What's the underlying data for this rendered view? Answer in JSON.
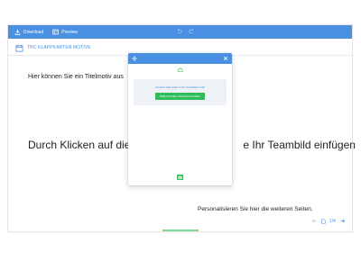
{
  "toolbar": {
    "download_label": "Download",
    "preview_label": "Preview",
    "undo_icon": "undo-icon",
    "redo_icon": "redo-icon"
  },
  "document": {
    "title": "TRC KLAPPKARTEN MOTIVE"
  },
  "canvas": {
    "title_motif_text": "Hier können Sie ein Titelmotiv aus",
    "team_photo_text_left": "Durch Klicken auf die w",
    "team_photo_text_right": "e Ihr Teambild einfügen",
    "personalize_text": "Personalisieren Sie hier die weiteren Seiten."
  },
  "pager": {
    "page_indicator": "1/4"
  },
  "modal": {
    "panel_text": "FÜGEN SIE HIER IHR TEAMBILD EIN",
    "search_button_label": "BIBLIOTHEK DURCHSUCHEN"
  },
  "colors": {
    "accent": "#4a90e2",
    "action_green": "#2ebd59"
  }
}
